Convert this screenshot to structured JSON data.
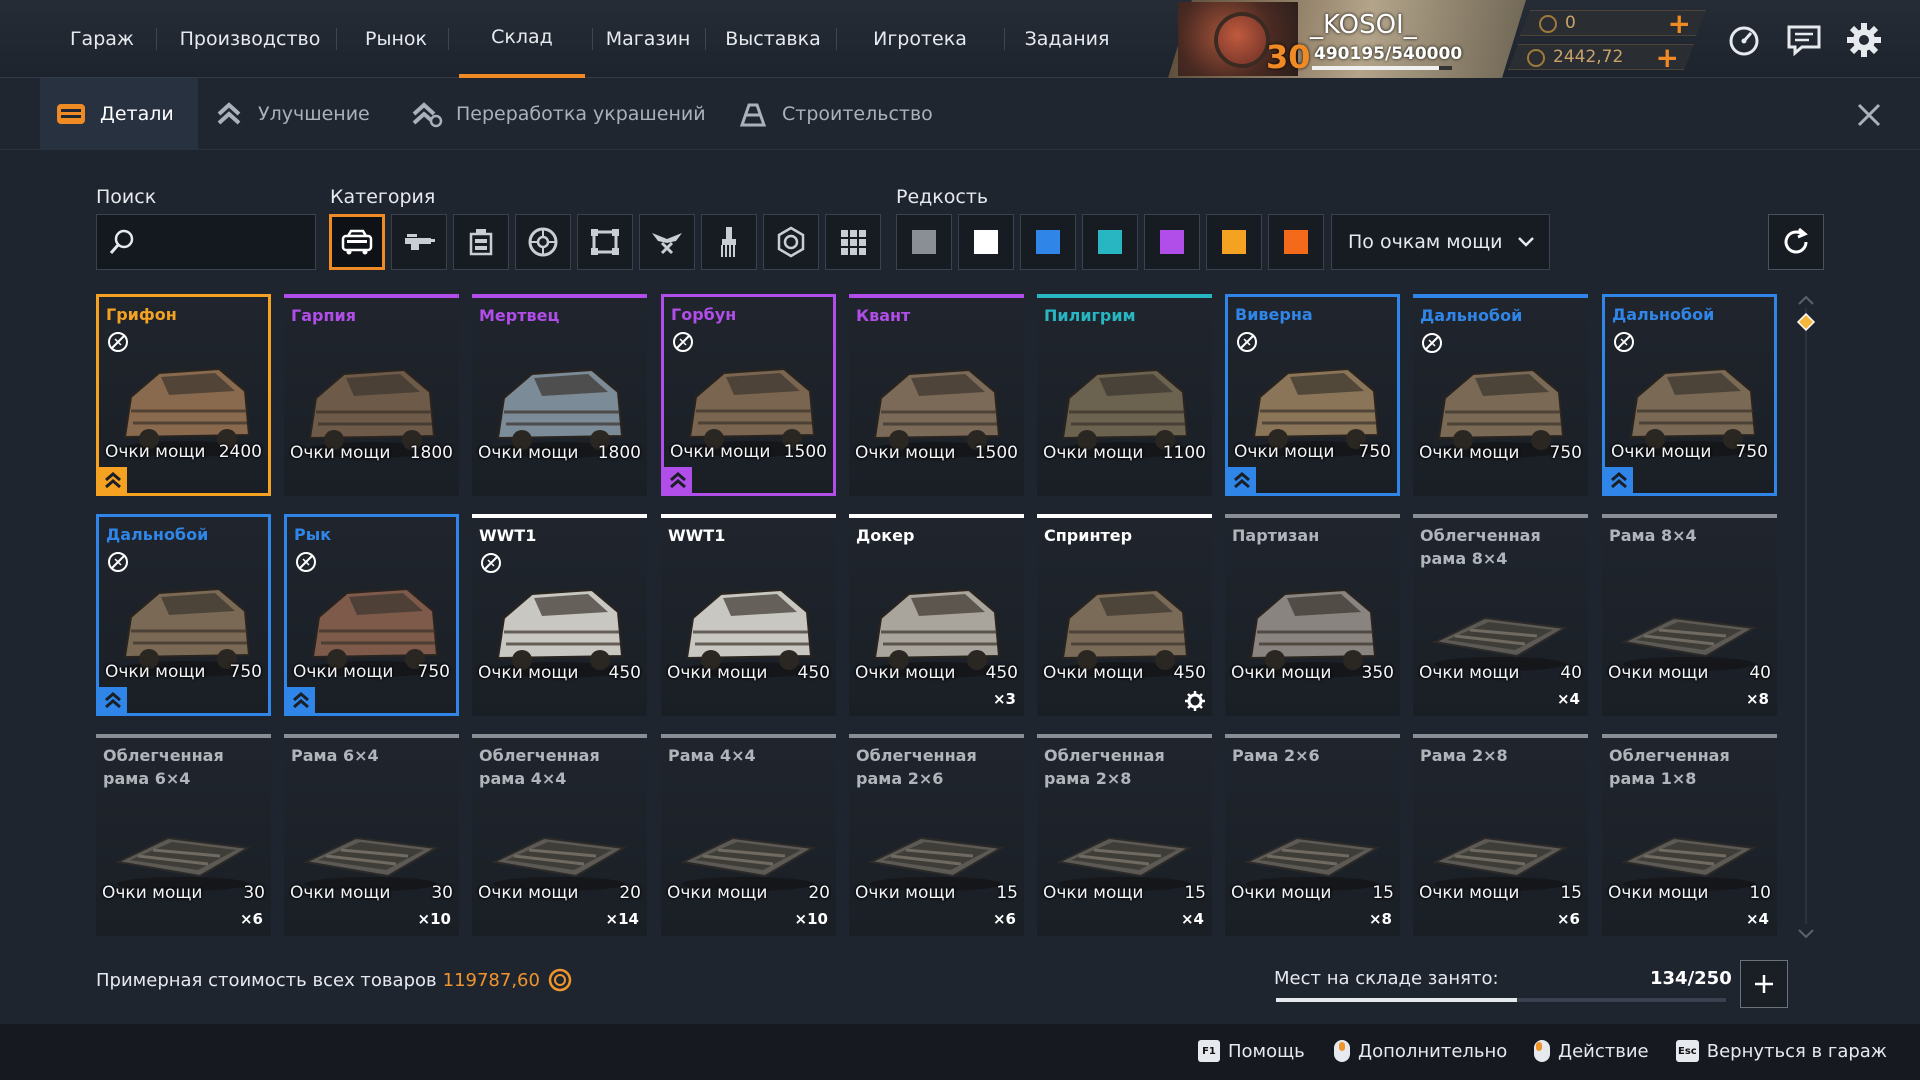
{
  "nav": {
    "items": [
      {
        "label": "Гараж"
      },
      {
        "label": "Производство"
      },
      {
        "label": "Рынок"
      },
      {
        "label": "Склад",
        "active": true
      },
      {
        "label": "Магазин"
      },
      {
        "label": "Выставка"
      },
      {
        "label": "Игротека"
      },
      {
        "label": "Задания"
      }
    ]
  },
  "profile": {
    "username": "_KOSOI_",
    "level": "30",
    "xp": "490195/540000",
    "xp_progress": 0.908
  },
  "currency": {
    "crowns": "0",
    "coins": "2442,72"
  },
  "tabs": [
    {
      "label": "Детали",
      "icon": "parts-icon",
      "active": true
    },
    {
      "label": "Улучшение",
      "icon": "upgrade-icon"
    },
    {
      "label": "Переработка украшений",
      "icon": "recycle-decor-icon"
    },
    {
      "label": "Строительство",
      "icon": "build-icon"
    }
  ],
  "filters": {
    "search_label": "Поиск",
    "search_value": "",
    "category_label": "Категория",
    "categories": [
      "cabins",
      "weapons",
      "modules",
      "wheels",
      "frames",
      "decor",
      "paint",
      "engines",
      "all"
    ],
    "rarity_label": "Редкость",
    "rarity_colors": [
      "#8a8f96",
      "#ffffff",
      "#2f86e8",
      "#27b6c2",
      "#b14de8",
      "#f5a223",
      "#f26a1a"
    ],
    "sort_value": "По очкам мощи"
  },
  "item_common": {
    "power_label": "Очки мощи"
  },
  "items": [
    {
      "name": "Грифон",
      "power": "2400",
      "qty": "",
      "color": "#f5a223",
      "framed": true,
      "no_trade": true,
      "upgrade": true
    },
    {
      "name": "Гарпия",
      "power": "1800",
      "qty": "",
      "color": "#b14de8",
      "framed": false,
      "no_trade": false,
      "upgrade": false
    },
    {
      "name": "Мертвец",
      "power": "1800",
      "qty": "",
      "color": "#b14de8",
      "framed": false,
      "no_trade": false,
      "upgrade": false
    },
    {
      "name": "Горбун",
      "power": "1500",
      "qty": "",
      "color": "#b14de8",
      "framed": true,
      "no_trade": true,
      "upgrade": true
    },
    {
      "name": "Квант",
      "power": "1500",
      "qty": "",
      "color": "#b14de8",
      "framed": false,
      "no_trade": false,
      "upgrade": false
    },
    {
      "name": "Пилигрим",
      "power": "1100",
      "qty": "",
      "color": "#27b6c2",
      "framed": false,
      "no_trade": false,
      "upgrade": false
    },
    {
      "name": "Виверна",
      "power": "750",
      "qty": "",
      "color": "#2f86e8",
      "framed": true,
      "no_trade": true,
      "upgrade": true
    },
    {
      "name": "Дальнобой",
      "power": "750",
      "qty": "",
      "color": "#2f86e8",
      "framed": false,
      "no_trade": true,
      "upgrade": false
    },
    {
      "name": "Дальнобой",
      "power": "750",
      "qty": "",
      "color": "#2f86e8",
      "framed": true,
      "no_trade": true,
      "upgrade": true
    },
    {
      "name": "Дальнобой",
      "power": "750",
      "qty": "",
      "color": "#2f86e8",
      "framed": true,
      "no_trade": true,
      "upgrade": true
    },
    {
      "name": "Рык",
      "power": "750",
      "qty": "",
      "color": "#2f86e8",
      "framed": true,
      "no_trade": true,
      "upgrade": true
    },
    {
      "name": "WWT1",
      "power": "450",
      "qty": "",
      "color": "#ffffff",
      "framed": false,
      "no_trade": true,
      "upgrade": false
    },
    {
      "name": "WWT1",
      "power": "450",
      "qty": "",
      "color": "#ffffff",
      "framed": false,
      "no_trade": false,
      "upgrade": false
    },
    {
      "name": "Докер",
      "power": "450",
      "qty": "×3",
      "color": "#ffffff",
      "framed": false,
      "no_trade": false,
      "upgrade": false
    },
    {
      "name": "Спринтер",
      "power": "450",
      "qty": "",
      "color": "#ffffff",
      "framed": false,
      "no_trade": false,
      "upgrade": false,
      "gear": true
    },
    {
      "name": "Партизан",
      "power": "350",
      "qty": "",
      "color": "#8a8f96",
      "framed": false,
      "no_trade": false,
      "upgrade": false
    },
    {
      "name": "Облегченная рама 8×4",
      "power": "40",
      "qty": "×4",
      "color": "#8a8f96",
      "framed": false,
      "no_trade": false,
      "upgrade": false
    },
    {
      "name": "Рама 8×4",
      "power": "40",
      "qty": "×8",
      "color": "#8a8f96",
      "framed": false,
      "no_trade": false,
      "upgrade": false
    },
    {
      "name": "Облегченная рама 6×4",
      "power": "30",
      "qty": "×6",
      "color": "#8a8f96",
      "framed": false,
      "no_trade": false,
      "upgrade": false
    },
    {
      "name": "Рама 6×4",
      "power": "30",
      "qty": "×10",
      "color": "#8a8f96",
      "framed": false,
      "no_trade": false,
      "upgrade": false
    },
    {
      "name": "Облегченная рама 4×4",
      "power": "20",
      "qty": "×14",
      "color": "#8a8f96",
      "framed": false,
      "no_trade": false,
      "upgrade": false
    },
    {
      "name": "Рама 4×4",
      "power": "20",
      "qty": "×10",
      "color": "#8a8f96",
      "framed": false,
      "no_trade": false,
      "upgrade": false
    },
    {
      "name": "Облегченная рама 2×6",
      "power": "15",
      "qty": "×6",
      "color": "#8a8f96",
      "framed": false,
      "no_trade": false,
      "upgrade": false
    },
    {
      "name": "Облегченная рама 2×8",
      "power": "15",
      "qty": "×4",
      "color": "#8a8f96",
      "framed": false,
      "no_trade": false,
      "upgrade": false
    },
    {
      "name": "Рама 2×6",
      "power": "15",
      "qty": "×8",
      "color": "#8a8f96",
      "framed": false,
      "no_trade": false,
      "upgrade": false
    },
    {
      "name": "Рама 2×8",
      "power": "15",
      "qty": "×6",
      "color": "#8a8f96",
      "framed": false,
      "no_trade": false,
      "upgrade": false
    },
    {
      "name": "Облегченная рама 1×8",
      "power": "10",
      "qty": "×4",
      "color": "#8a8f96",
      "framed": false,
      "no_trade": false,
      "upgrade": false
    }
  ],
  "footer": {
    "cost_label": "Примерная стоимость всех товаров",
    "cost_value": "119787,60",
    "storage_label": "Мест на складе занято:",
    "storage_value": "134/250",
    "storage_fill": 0.536
  },
  "hints": [
    {
      "key": "F1",
      "label": "Помощь"
    },
    {
      "key": "mouse-middle",
      "label": "Дополнительно"
    },
    {
      "key": "mouse-left",
      "label": "Действие"
    },
    {
      "key": "Esc",
      "label": "Вернуться в гараж"
    }
  ],
  "colors": {
    "accent": "#f08a24",
    "background": "#1f252f"
  }
}
